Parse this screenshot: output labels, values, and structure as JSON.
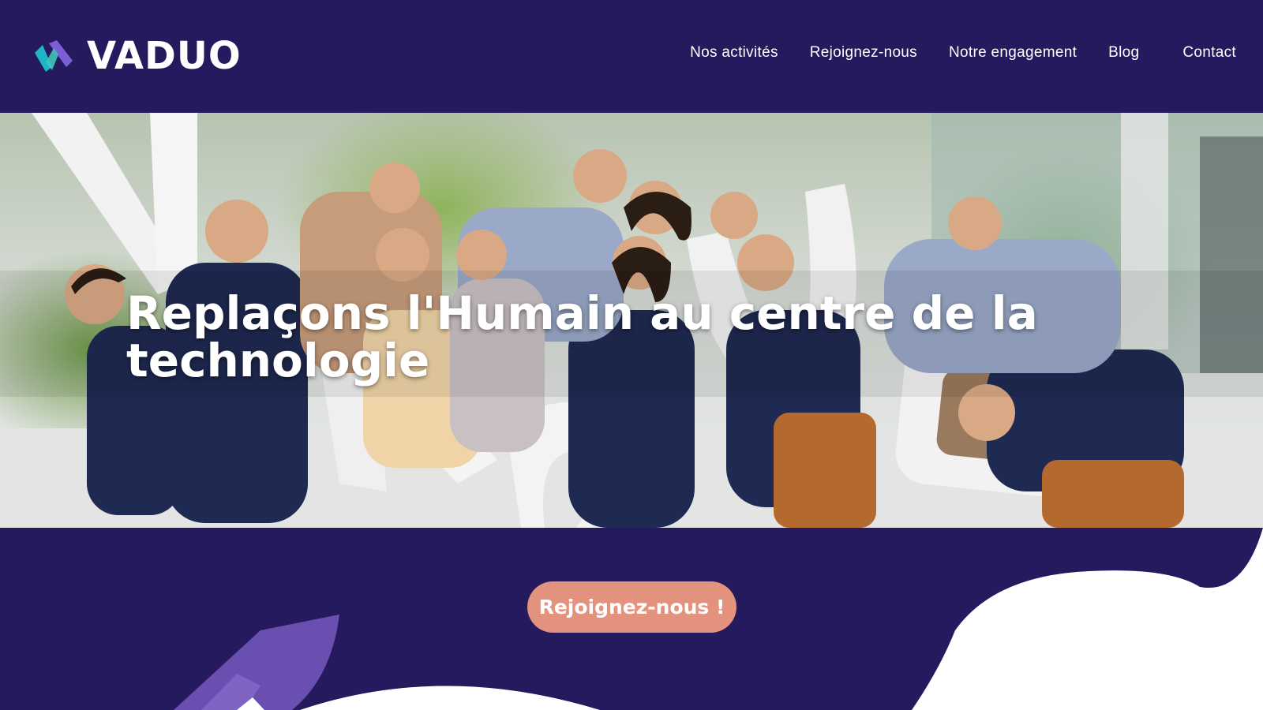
{
  "header": {
    "logo_text": "VADUO",
    "nav": [
      {
        "label": "Nos activités"
      },
      {
        "label": "Rejoignez-nous"
      },
      {
        "label": "Notre engagement"
      },
      {
        "label": "Blog"
      },
      {
        "label": "Contact"
      }
    ]
  },
  "hero": {
    "title_line1": "Replaçons l'Humain au centre de la",
    "title_line2": "technologie"
  },
  "cta": {
    "label": "Rejoignez-nous !"
  },
  "colors": {
    "brand_navy": "#251a5e",
    "cta_salmon": "#e3927e",
    "logo_teal": "#1fb5c7",
    "logo_purple": "#7b5fd6",
    "decor_purple": "#6a4fb0"
  },
  "icons": {
    "logo": "vaduo-logo-mark-icon"
  }
}
